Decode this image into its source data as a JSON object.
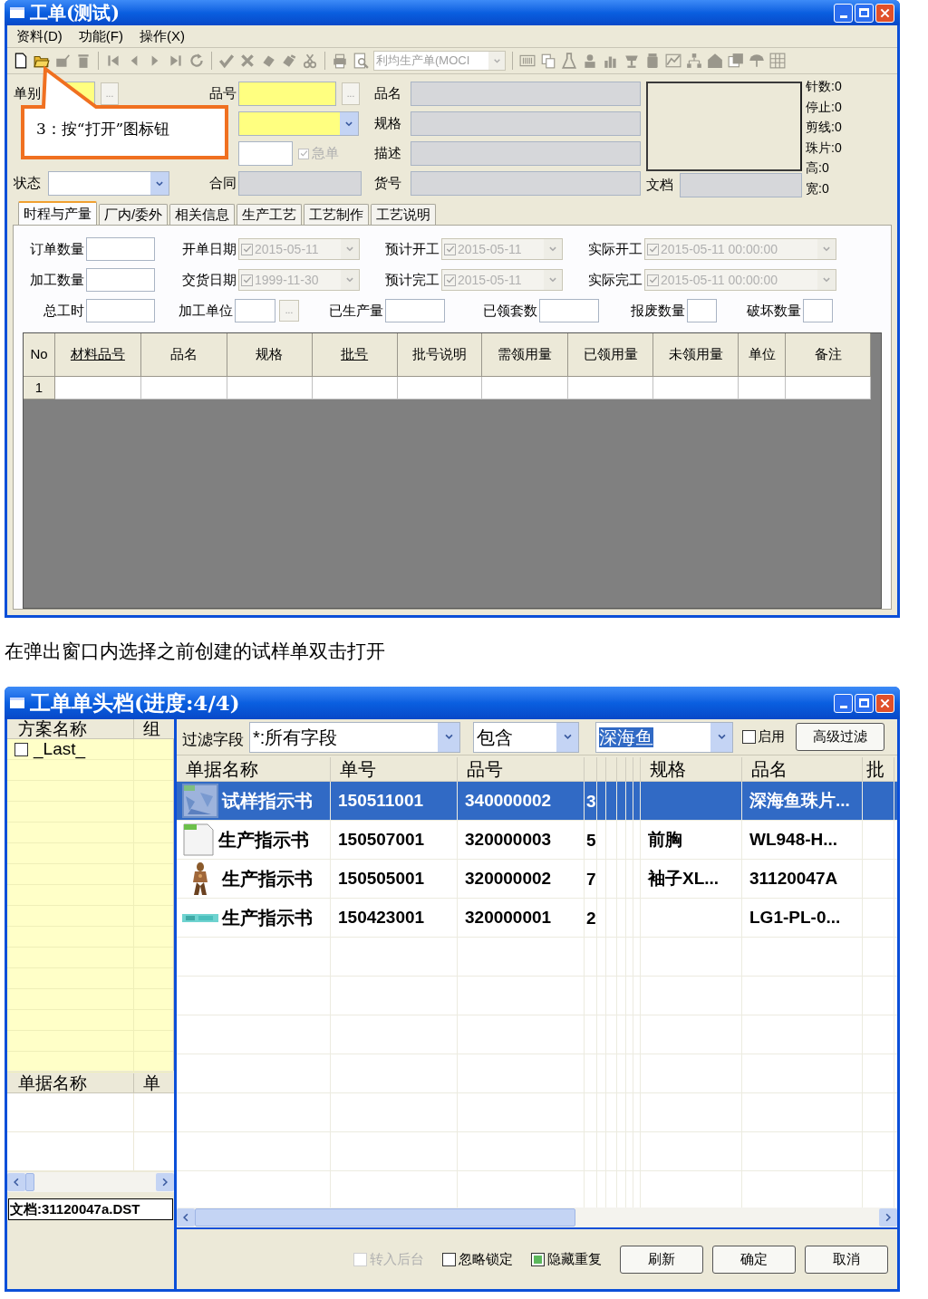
{
  "work_order_window": {
    "title": "工单(测试)",
    "menu": [
      "资料(D)",
      "功能(F)",
      "操作(X)"
    ],
    "toolbar_combo": "利均生产单(MOCI",
    "form": {
      "rows": [
        {
          "label_1": "单别",
          "browse_1": "...",
          "label_2": "品号",
          "browse_2": "...",
          "label_3": "品名"
        },
        {
          "label_3": "规格"
        },
        {
          "label_3": "描述",
          "urgent": {
            "label": "急单",
            "checked": true
          }
        },
        {
          "label_1": "状态",
          "label_2": "合同",
          "label_3": "货号"
        }
      ],
      "document_label": "文档",
      "stats": [
        "针数:0",
        "停止:0",
        "剪线:0",
        "珠片:0",
        "高:0",
        "宽:0"
      ]
    },
    "callout": "3：按“打开”图标钮",
    "tabs": [
      {
        "label": "时程与产量",
        "selected": true
      },
      {
        "label": "厂内/委外",
        "selected": false
      },
      {
        "label": "相关信息",
        "selected": false
      },
      {
        "label": "生产工艺",
        "selected": false
      },
      {
        "label": "工艺制作",
        "selected": false
      },
      {
        "label": "工艺说明",
        "selected": false
      }
    ],
    "field_rows": [
      [
        {
          "label": "订单数量",
          "kind": "text"
        },
        {
          "label": "开单日期",
          "kind": "date",
          "checked": true,
          "value": "2015-05-11"
        },
        {
          "label": "预计开工",
          "kind": "date",
          "checked": true,
          "value": "2015-05-11"
        },
        {
          "label": "实际开工",
          "kind": "date",
          "checked": true,
          "value": "2015-05-11 00:00:00"
        }
      ],
      [
        {
          "label": "加工数量",
          "kind": "text"
        },
        {
          "label": "交货日期",
          "kind": "date",
          "checked": true,
          "value": "1999-11-30"
        },
        {
          "label": "预计完工",
          "kind": "date",
          "checked": true,
          "value": "2015-05-11"
        },
        {
          "label": "实际完工",
          "kind": "date",
          "checked": true,
          "value": "2015-05-11 00:00:00"
        }
      ],
      [
        {
          "label": "总工时",
          "kind": "text"
        },
        {
          "label": "加工单位",
          "kind": "lookup",
          "button": "..."
        },
        {
          "label": "已生产量",
          "kind": "text"
        },
        {
          "label": "已领套数",
          "kind": "text"
        },
        {
          "label": "报废数量",
          "kind": "text"
        },
        {
          "label": "破坏数量",
          "kind": "text"
        }
      ]
    ],
    "materials_table": {
      "columns": [
        {
          "label": "No",
          "underlined": false
        },
        {
          "label": "材料品号",
          "underlined": true
        },
        {
          "label": "品名",
          "underlined": false
        },
        {
          "label": "规格",
          "underlined": false
        },
        {
          "label": "批号",
          "underlined": true
        },
        {
          "label": "批号说明",
          "underlined": false
        },
        {
          "label": "需领用量",
          "underlined": false
        },
        {
          "label": "已领用量",
          "underlined": false
        },
        {
          "label": "未领用量",
          "underlined": false
        },
        {
          "label": "单位",
          "underlined": false
        },
        {
          "label": "备注",
          "underlined": false
        }
      ],
      "rows": [
        [
          "1"
        ]
      ]
    }
  },
  "caption": "在弹出窗口内选择之前创建的试样单双击打开",
  "header_window": {
    "title": "工单单头档(进度:4/4)",
    "scheme_list": {
      "columns": [
        "方案名称",
        "组"
      ],
      "items": [
        {
          "label": "_Last_",
          "checked": false
        }
      ]
    },
    "document_list": {
      "columns": [
        "单据名称",
        "单"
      ]
    },
    "document_field": "文档:31120047a.DST",
    "filter": {
      "label": "过滤字段",
      "field": "*:所有字段",
      "operator": "包含",
      "value": "深海鱼",
      "enable": {
        "label": "启用",
        "checked": false
      },
      "advanced_button": "高级过滤"
    },
    "table": {
      "columns": [
        "单据名称",
        "单号",
        "品号",
        "",
        "规格",
        "品名",
        "批"
      ],
      "rows": [
        {
          "selected": true,
          "cells": [
            "试样指示书",
            "150511001",
            "340000002",
            "3",
            "",
            "深海鱼珠片..."
          ]
        },
        {
          "selected": false,
          "kind": "document",
          "cells": [
            "生产指示书",
            "150507001",
            "320000003",
            "5",
            "前胸",
            "WL948-H..."
          ]
        },
        {
          "selected": false,
          "cells": [
            "生产指示书",
            "150505001",
            "320000002",
            "7",
            "袖子XL...",
            "31120047A"
          ]
        },
        {
          "selected": false,
          "cells": [
            "生产指示书",
            "150423001",
            "320000001",
            "2",
            "",
            "LG1-PL-0..."
          ]
        }
      ]
    },
    "options": [
      {
        "label": "转入后台",
        "checked": false,
        "disabled": true
      },
      {
        "label": "忽略锁定",
        "checked": false,
        "disabled": false
      },
      {
        "label": "隐藏重复",
        "checked": true,
        "disabled": false
      }
    ],
    "buttons": [
      "刷新",
      "确定",
      "取消"
    ]
  }
}
